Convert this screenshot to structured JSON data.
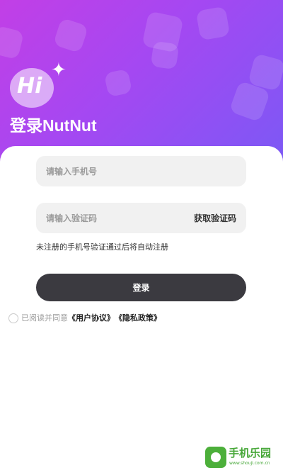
{
  "header": {
    "logo_text": "Hi",
    "title": "登录NutNut"
  },
  "form": {
    "phone_placeholder": "请输入手机号",
    "code_placeholder": "请输入验证码",
    "get_code_label": "获取验证码",
    "hint": "未注册的手机号验证通过后将自动注册",
    "login_label": "登录"
  },
  "agreement": {
    "prefix": "已阅读并同意",
    "user_agreement": "《用户协议》",
    "privacy_policy": "《隐私政策》",
    "checked": false
  },
  "watermark": {
    "title": "手机乐园",
    "url": "www.shouji.com.cn"
  },
  "colors": {
    "gradient_start": "#c23fe6",
    "gradient_end": "#7b59f5",
    "button_bg": "#3b3a40",
    "field_bg": "#f1f1f1",
    "watermark_green": "#48a83a"
  },
  "icons": {
    "logo": "hi-chat-bubble-icon",
    "sparkle": "sparkle-icon",
    "radio": "radio-unchecked-icon",
    "watermark": "watermark-logo-icon"
  }
}
